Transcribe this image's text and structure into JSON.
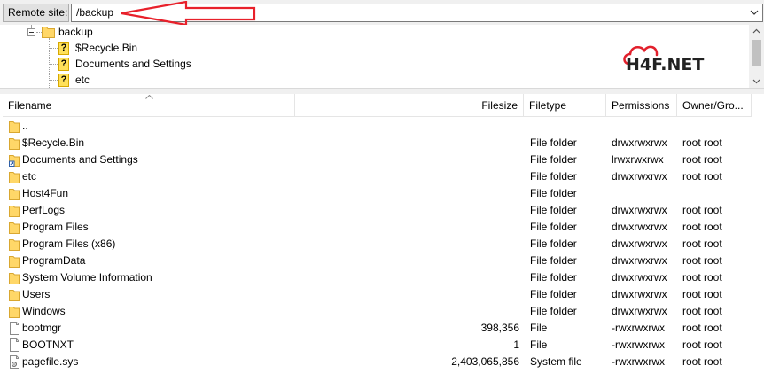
{
  "remote_site": {
    "label": "Remote site:",
    "path": "/backup"
  },
  "tree": {
    "root": "backup",
    "children": [
      "$Recycle.Bin",
      "Documents and Settings",
      "etc"
    ]
  },
  "logo_text": "H4F.NET",
  "columns": {
    "filename": "Filename",
    "filesize": "Filesize",
    "filetype": "Filetype",
    "permissions": "Permissions",
    "owner": "Owner/Gro..."
  },
  "files": [
    {
      "icon": "folder-icon",
      "name": "..",
      "size": "",
      "type": "",
      "perm": "",
      "owner": ""
    },
    {
      "icon": "folder-icon",
      "name": "$Recycle.Bin",
      "size": "",
      "type": "File folder",
      "perm": "drwxrwxrwx",
      "owner": "root root"
    },
    {
      "icon": "folder-link-icon",
      "name": "Documents and Settings",
      "size": "",
      "type": "File folder",
      "perm": "lrwxrwxrwx",
      "owner": "root root"
    },
    {
      "icon": "folder-icon",
      "name": "etc",
      "size": "",
      "type": "File folder",
      "perm": "drwxrwxrwx",
      "owner": "root root"
    },
    {
      "icon": "folder-icon",
      "name": "Host4Fun",
      "size": "",
      "type": "File folder",
      "perm": "",
      "owner": ""
    },
    {
      "icon": "folder-icon",
      "name": "PerfLogs",
      "size": "",
      "type": "File folder",
      "perm": "drwxrwxrwx",
      "owner": "root root"
    },
    {
      "icon": "folder-icon",
      "name": "Program Files",
      "size": "",
      "type": "File folder",
      "perm": "drwxrwxrwx",
      "owner": "root root"
    },
    {
      "icon": "folder-icon",
      "name": "Program Files (x86)",
      "size": "",
      "type": "File folder",
      "perm": "drwxrwxrwx",
      "owner": "root root"
    },
    {
      "icon": "folder-icon",
      "name": "ProgramData",
      "size": "",
      "type": "File folder",
      "perm": "drwxrwxrwx",
      "owner": "root root"
    },
    {
      "icon": "folder-icon",
      "name": "System Volume Information",
      "size": "",
      "type": "File folder",
      "perm": "drwxrwxrwx",
      "owner": "root root"
    },
    {
      "icon": "folder-icon",
      "name": "Users",
      "size": "",
      "type": "File folder",
      "perm": "drwxrwxrwx",
      "owner": "root root"
    },
    {
      "icon": "folder-icon",
      "name": "Windows",
      "size": "",
      "type": "File folder",
      "perm": "drwxrwxrwx",
      "owner": "root root"
    },
    {
      "icon": "file-icon",
      "name": "bootmgr",
      "size": "398,356",
      "type": "File",
      "perm": "-rwxrwxrwx",
      "owner": "root root"
    },
    {
      "icon": "file-icon",
      "name": "BOOTNXT",
      "size": "1",
      "type": "File",
      "perm": "-rwxrwxrwx",
      "owner": "root root"
    },
    {
      "icon": "system-file-icon",
      "name": "pagefile.sys",
      "size": "2,403,065,856",
      "type": "System file",
      "perm": "-rwxrwxrwx",
      "owner": "root root"
    }
  ],
  "colors": {
    "annotation_arrow": "#e8202a",
    "folder": "#ffd768",
    "logo_red": "#e2202c"
  }
}
